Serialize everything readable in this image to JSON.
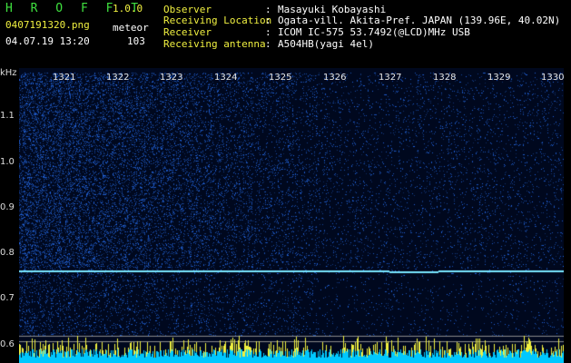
{
  "header": {
    "app_title": "H R O F F T",
    "version": "1.0.0",
    "filename": "0407191320.png",
    "mode": "meteor",
    "datetime": "04.07.19 13:20",
    "count": "103",
    "fields": [
      {
        "label": "Observer",
        "value": "Masayuki Kobayashi"
      },
      {
        "label": "Receiving Location",
        "value": "Ogata-vill. Akita-Pref. JAPAN (139.96E, 40.02N)"
      },
      {
        "label": "Receiver",
        "value": "ICOM IC-575 53.7492(@LCD)MHz USB"
      },
      {
        "label": "Receiving antenna",
        "value": "A504HB(yagi 4el)"
      }
    ]
  },
  "spectrogram": {
    "y_unit": "kHz",
    "y_ticks": [
      "1.1",
      "1.0",
      "0.9",
      "0.8",
      "0.7",
      "0.6"
    ],
    "time_ticks": [
      "1321",
      "1322",
      "1323",
      "1324",
      "1325",
      "1326",
      "1327",
      "1328",
      "1329",
      "1330"
    ],
    "colors": {
      "background": "#00081e",
      "signal": "#3aa8ff",
      "carrier": "#78e6ff",
      "header_green": "#3fe03f",
      "noise_bar": "#00c8ff",
      "noise_peak": "#f0f040"
    }
  }
}
